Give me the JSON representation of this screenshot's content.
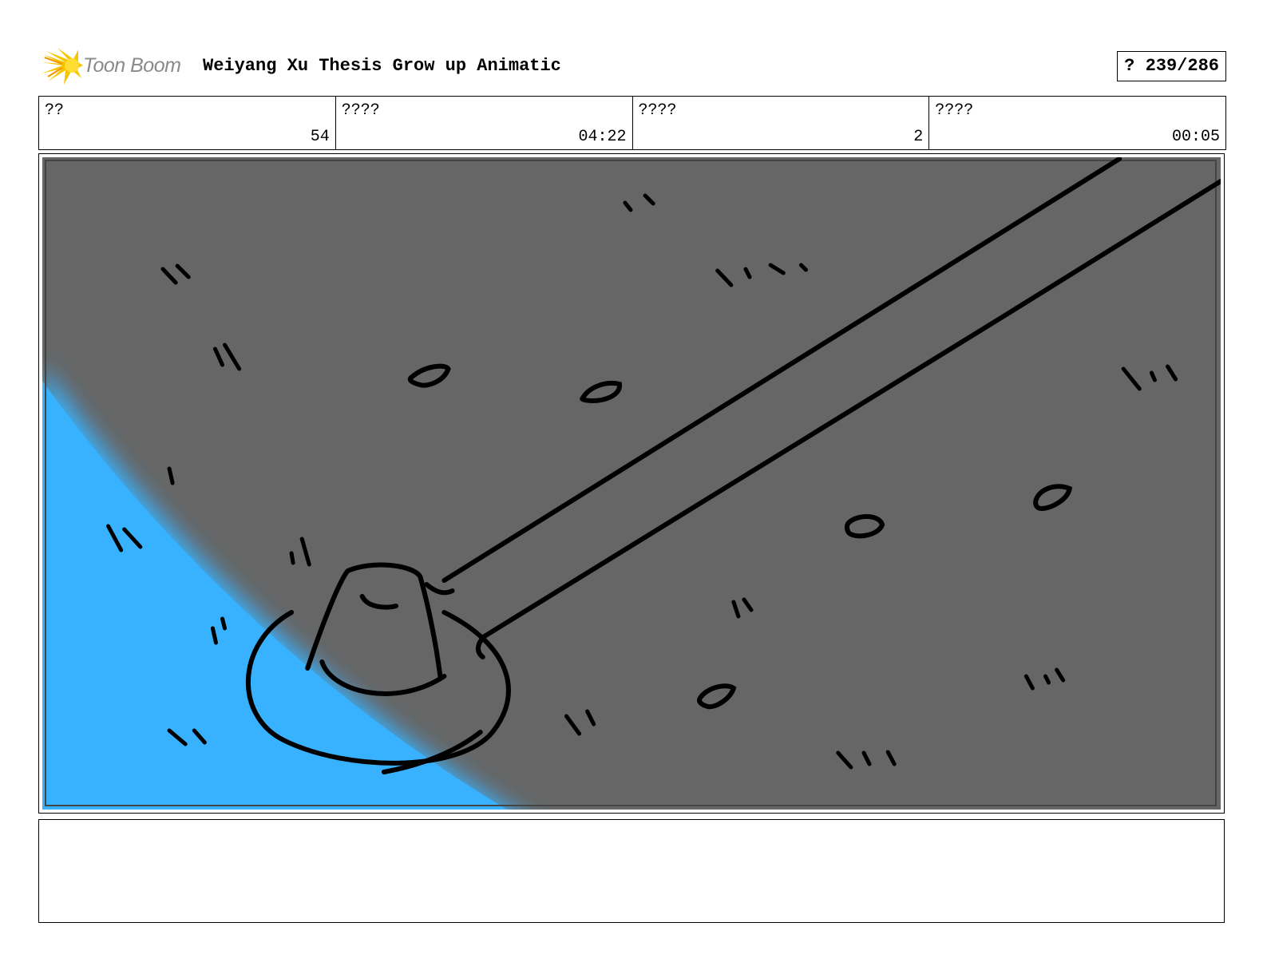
{
  "header": {
    "logo_text": "Toon Boom",
    "project_title": "Weiyang Xu Thesis Grow up Animatic",
    "page_label": "? 239/286"
  },
  "info": [
    {
      "label": "??",
      "value": "54"
    },
    {
      "label": "????",
      "value": "04:22"
    },
    {
      "label": "????",
      "value": "2"
    },
    {
      "label": "????",
      "value": "00:05"
    }
  ],
  "panel": {
    "background_color": "#666666",
    "glow_color": "#38b2ff",
    "line_color": "#000000"
  },
  "caption": {
    "text": ""
  }
}
